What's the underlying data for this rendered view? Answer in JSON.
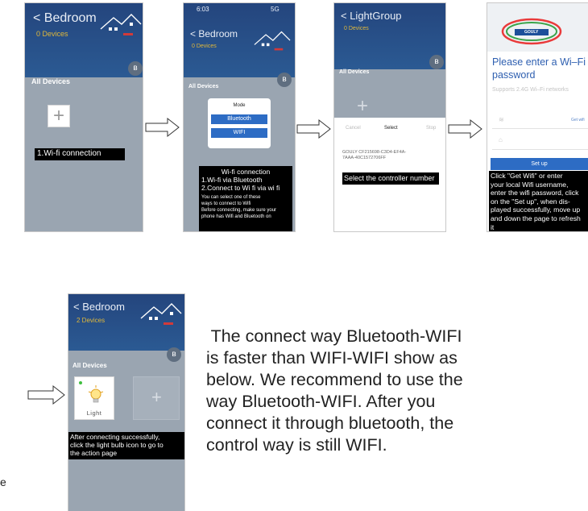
{
  "screen1": {
    "title": "< Bedroom",
    "subtitle": "0 Devices",
    "section": "All Devices",
    "caption": "1.Wi-fi connection"
  },
  "screen2": {
    "status_time": "6:03",
    "status_right": "5G",
    "title": "< Bedroom",
    "subtitle": "0 Devices",
    "section": "All Devices",
    "dialog_title": "Mode",
    "btn_bluetooth": "Bluetooth",
    "btn_wifi": "WIFI",
    "caption_lines": [
      "Wi-fi connection",
      "1.Wi-fi via Bluetooth",
      "2.Connect to Wi fi via wi fi"
    ],
    "caption_small": [
      "You can select one of these",
      "ways to connect to Wifi",
      "Before connecting, make sure your",
      "phone has Wifi and Bluetooth on"
    ]
  },
  "screen3": {
    "title": "< LightGroup",
    "subtitle": "0 Devices",
    "section": "All Devices",
    "cancel": "Cancel",
    "select": "Select",
    "stop": "Stop",
    "device_id_1": "GOULY CF215698-C3D4-EF4A-",
    "device_id_2": "7AAA-40C1572706FF",
    "caption": "Select the controller number"
  },
  "screen4": {
    "logo_text": "GOULY",
    "heading_1": "Please enter a Wi–Fi",
    "heading_2": "password",
    "note": "Supports 2.4G Wi–Fi networks",
    "get_wifi": "Get wifi",
    "setup": "Set up",
    "caption_lines": [
      "Click  \"Get Wifi\"  or enter",
      "your local Wifi username,",
      "enter the wifi password, click",
      "on the  \"Set up\", when dis-",
      "played successfully, move up",
      "and down the page to refresh",
      "it"
    ]
  },
  "screen5": {
    "title": "< Bedroom",
    "subtitle": "2 Devices",
    "section": "All Devices",
    "device_label": "Light",
    "caption_lines": [
      "After connecting successfully,",
      "click the light bulb icon to go to",
      "the action page"
    ]
  },
  "left_edge_text": "e",
  "description_lines": [
    " The connect way Bluetooth-WIFI",
    "is faster than WIFI-WIFI show as",
    "below. We recommend to use the",
    "way Bluetooth-WIFI. After you",
    "connect it through bluetooth, the",
    "control way is still WIFI."
  ]
}
